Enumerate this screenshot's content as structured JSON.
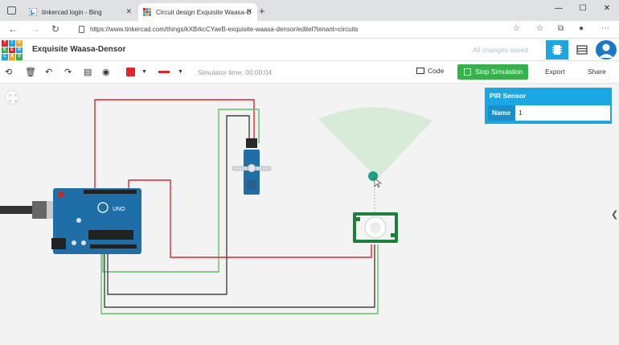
{
  "browser": {
    "tabs": [
      {
        "title": "tinkercad login - Bing",
        "active": false
      },
      {
        "title": "Circuit design Exquisite Waasa-D",
        "active": true
      }
    ],
    "url": "https://www.tinkercad.com/things/kXBrkcCYaeB-exquisite-waasa-densor/editel?tenant=circuits"
  },
  "app": {
    "logo_letters": [
      "T",
      "I",
      "N",
      "K",
      "E",
      "R",
      "C",
      "A",
      "D"
    ],
    "project_title": "Exquisite Waasa-Densor",
    "save_status": "All changes saved"
  },
  "toolbar": {
    "simulator_time": "Simulator time: 00:00:04",
    "code_label": "Code",
    "stop_label": "Stop Simulation",
    "export_label": "Export",
    "share_label": "Share"
  },
  "inspector": {
    "title": "PIR Sensor",
    "name_label": "Name",
    "name_value": "1"
  },
  "board": {
    "label": "UNO"
  },
  "colors": {
    "accent": "#1aa7e3",
    "sim_green": "#35b24a",
    "wire_red": "#e0252b",
    "wire_green": "#5cc464",
    "wire_dark": "#333333",
    "arduino_blue": "#1e6fa8"
  }
}
